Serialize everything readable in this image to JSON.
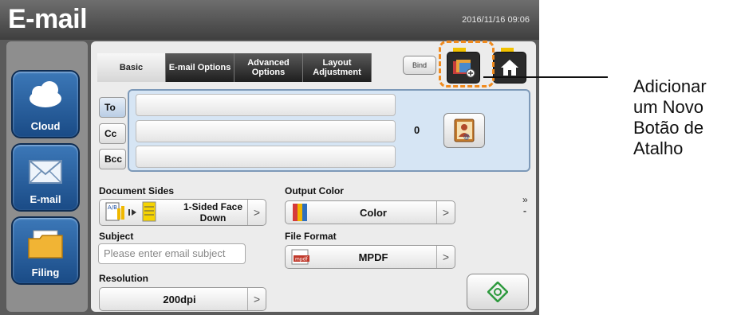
{
  "app": {
    "title": "E-mail",
    "datetime": "2016/11/16 09:06"
  },
  "sidebar": {
    "items": [
      {
        "label": "Cloud",
        "icon": "cloud-icon"
      },
      {
        "label": "E-mail",
        "icon": "envelope-icon"
      },
      {
        "label": "Filing",
        "icon": "folder-icon"
      }
    ]
  },
  "tabs": [
    {
      "label": "Basic",
      "active": true
    },
    {
      "label": "E-mail Options",
      "active": false
    },
    {
      "label": "Advanced Options",
      "active": false
    },
    {
      "label": "Layout Adjustment",
      "active": false
    }
  ],
  "toolbar": {
    "bind_label": "Bind",
    "add_shortcut_icon": "add-shortcut-icon",
    "home_icon": "home-icon"
  },
  "recipients": {
    "to_label": "To",
    "cc_label": "Cc",
    "bcc_label": "Bcc",
    "count": "0",
    "address_book_icon": "address-book-icon"
  },
  "document_sides": {
    "label": "Document Sides",
    "value": "1-Sided Face Down"
  },
  "output_color": {
    "label": "Output Color",
    "value": "Color"
  },
  "subject": {
    "label": "Subject",
    "placeholder": "Please enter email subject"
  },
  "file_format": {
    "label": "File Format",
    "value": "MPDF"
  },
  "resolution": {
    "label": "Resolution",
    "value": "200dpi"
  },
  "annotation": {
    "text": "Adicionar um Novo Botão de Atalho"
  },
  "colors": {
    "highlight": "#f08a1d",
    "accent_blue": "#1a4b86",
    "recipient_bg": "#d6e5f4"
  }
}
